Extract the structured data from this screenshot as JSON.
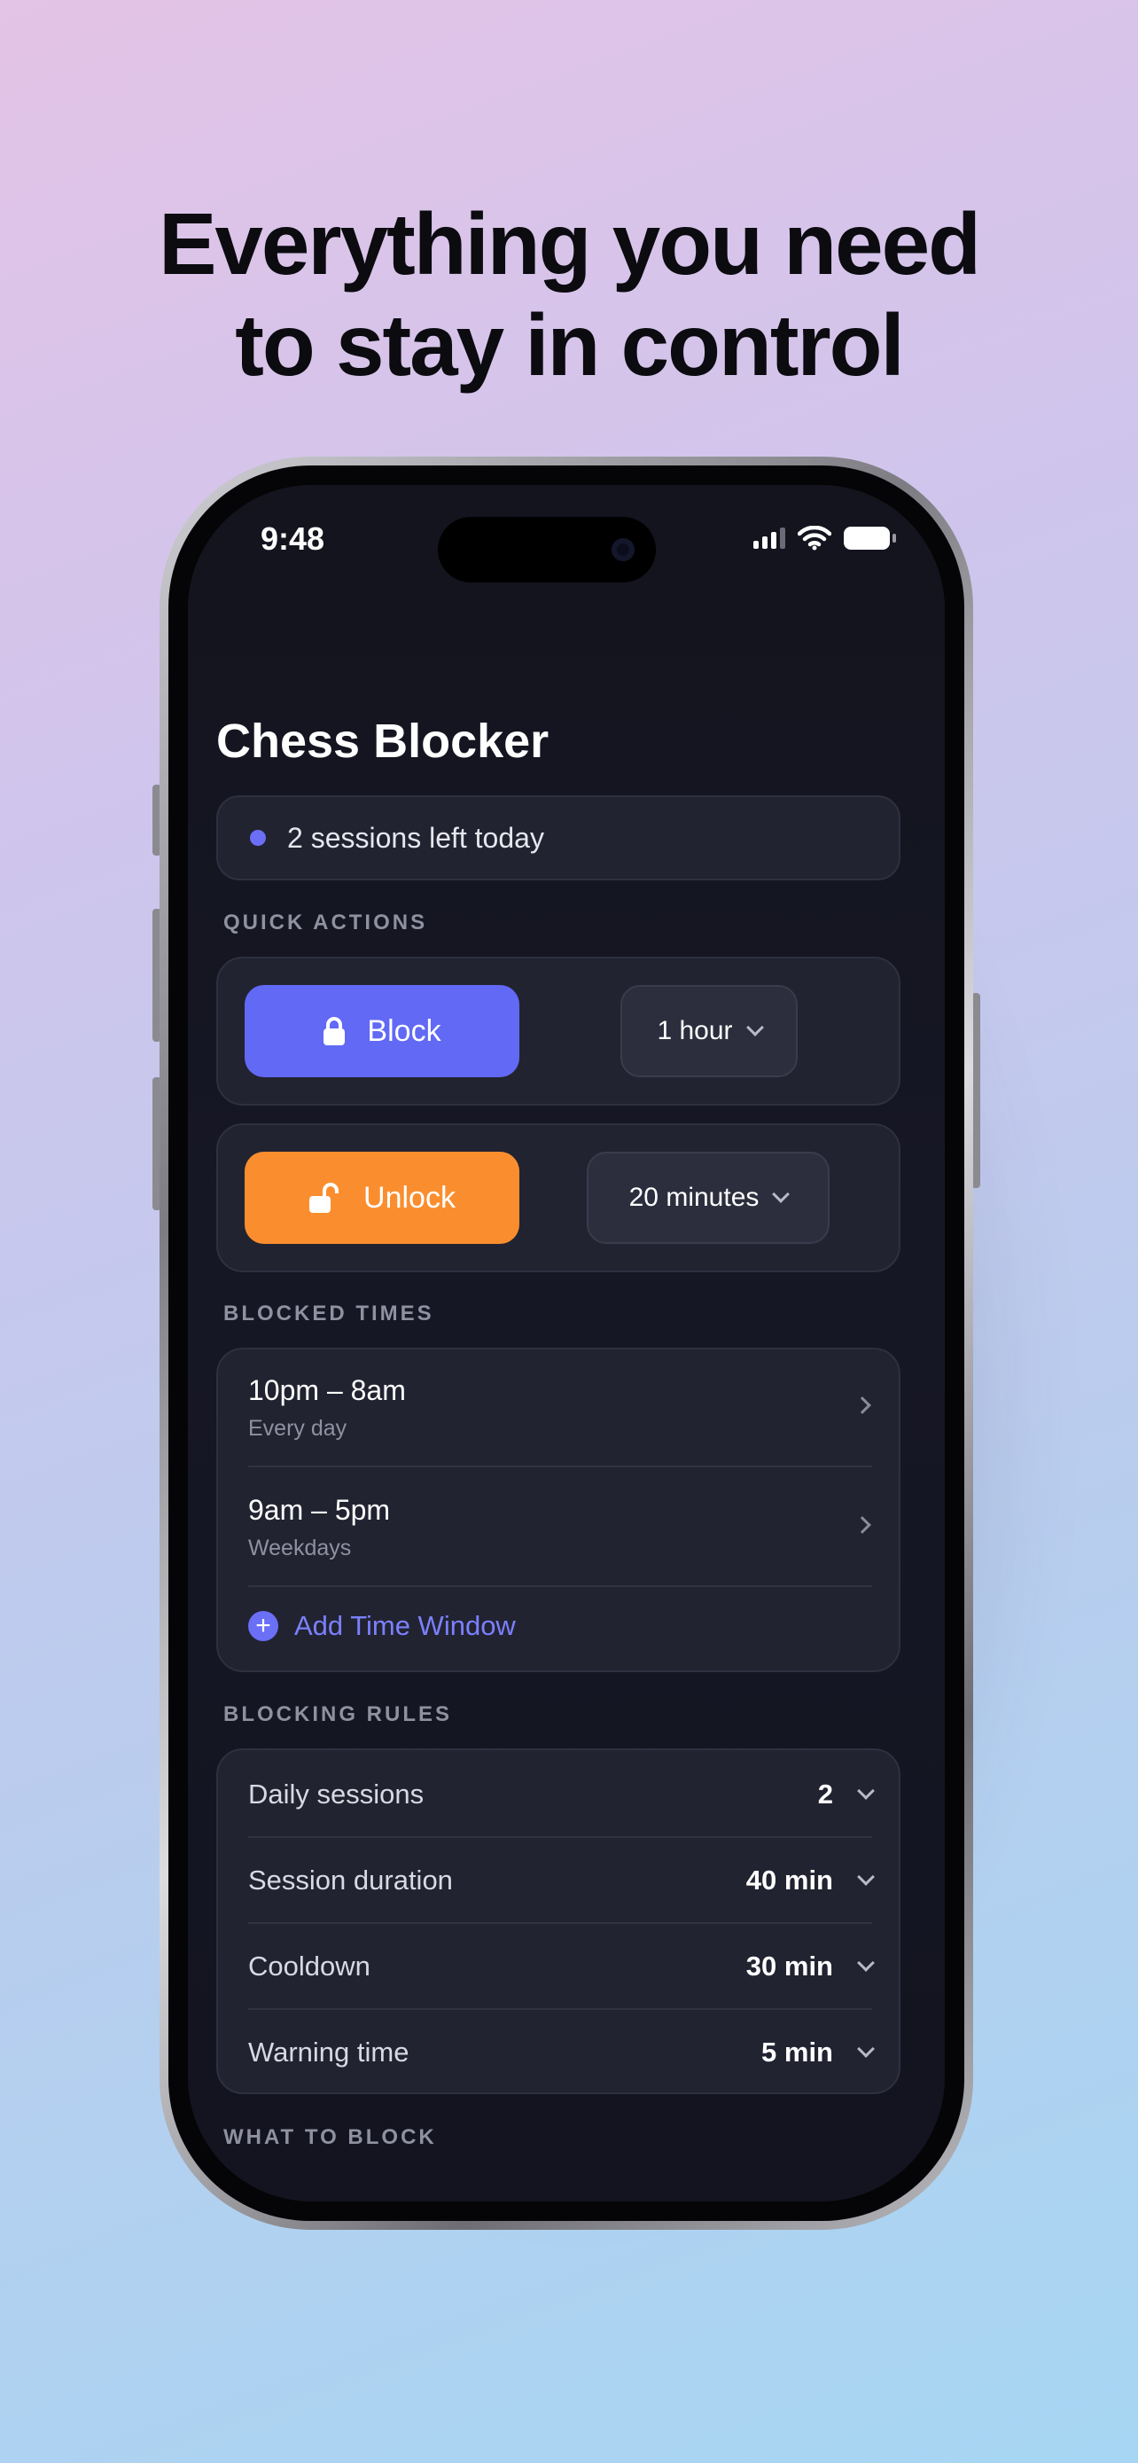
{
  "headline": {
    "line1": "Everything you need",
    "line2": "to stay in control"
  },
  "status_bar": {
    "time": "9:48",
    "icons": [
      "signal-icon",
      "wifi-icon",
      "battery-icon"
    ]
  },
  "app": {
    "title": "Chess Blocker",
    "status_text": "2 sessions left today",
    "accent": "#6169f5",
    "unlock_color": "#fa8e2f"
  },
  "quick_actions": {
    "label": "QUICK ACTIONS",
    "block": {
      "label": "Block",
      "duration": "1 hour",
      "icon": "lock-icon"
    },
    "unlock": {
      "label": "Unlock",
      "duration": "20 minutes",
      "icon": "unlock-icon"
    }
  },
  "blocked_times": {
    "label": "BLOCKED TIMES",
    "items": [
      {
        "title": "10pm – 8am",
        "subtitle": "Every day"
      },
      {
        "title": "9am – 5pm",
        "subtitle": "Weekdays"
      }
    ],
    "add_label": "Add Time Window"
  },
  "blocking_rules": {
    "label": "BLOCKING RULES",
    "items": [
      {
        "label": "Daily sessions",
        "value": "2"
      },
      {
        "label": "Session duration",
        "value": "40 min"
      },
      {
        "label": "Cooldown",
        "value": "30 min"
      },
      {
        "label": "Warning time",
        "value": "5 min"
      }
    ]
  },
  "what_to_block": {
    "label": "WHAT TO BLOCK"
  }
}
